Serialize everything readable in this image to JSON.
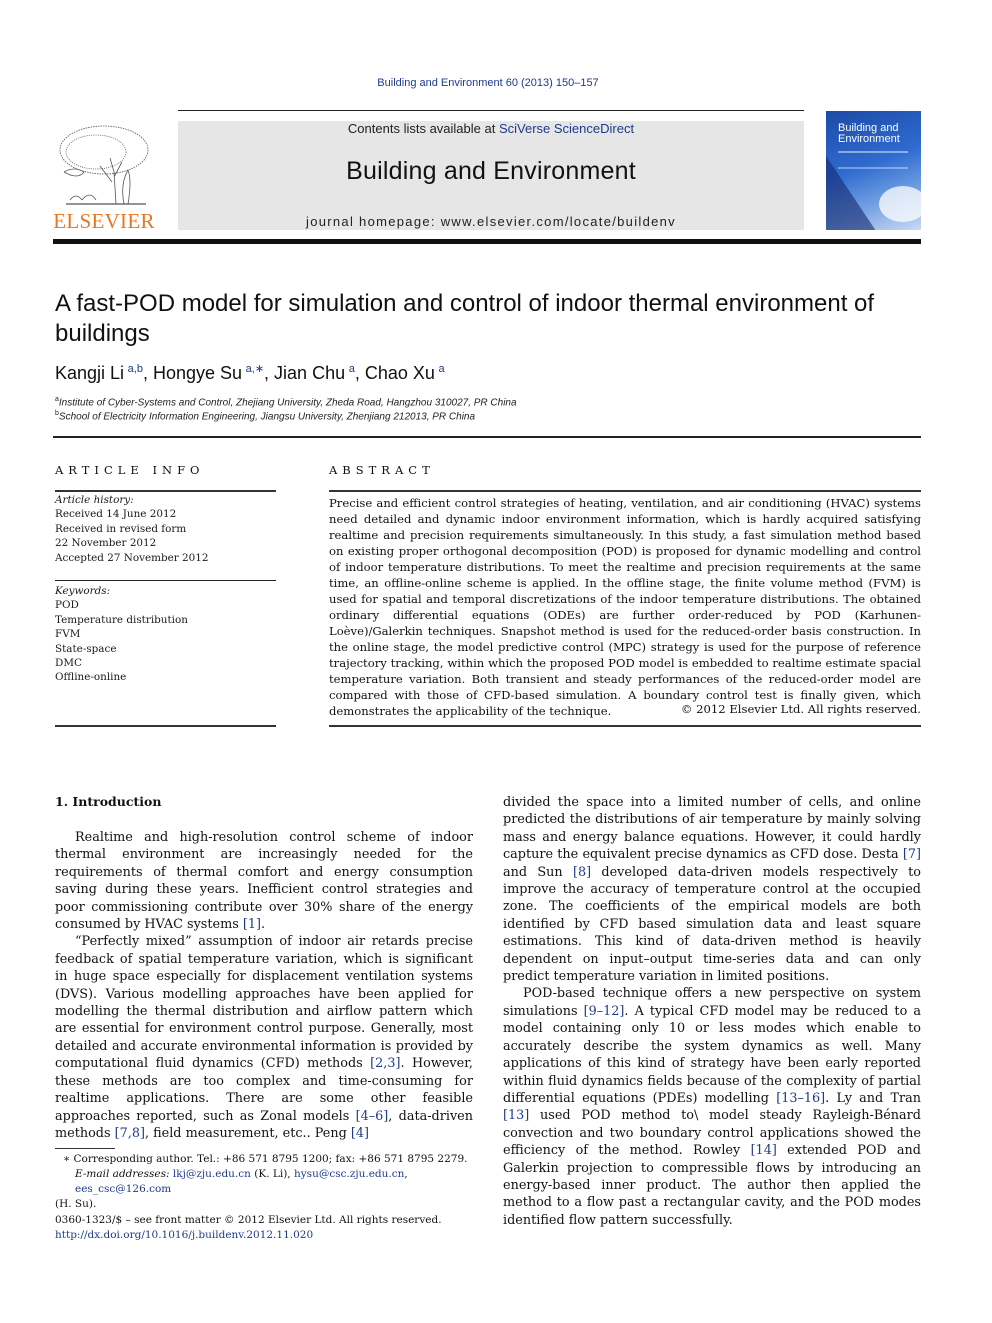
{
  "journal_ref": "Building and Environment 60 (2013) 150–157",
  "masthead": {
    "contents_prefix": "Contents lists available at ",
    "contents_link": "SciVerse ScienceDirect",
    "journal_title": "Building and Environment",
    "homepage": "journal homepage: www.elsevier.com/locate/buildenv",
    "publisher_logo": "ELSEVIER",
    "cover_title_line1": "Building and",
    "cover_title_line2": "Environment"
  },
  "colors": {
    "link": "#1f3a8a",
    "elsevier_orange": "#e87722",
    "masthead_bg": "#e6e6e6"
  },
  "article": {
    "title": "A fast-POD model for simulation and control of indoor thermal environment of buildings",
    "authors": [
      {
        "name": "Kangji Li",
        "sup": "a,b"
      },
      {
        "name": "Hongye Su",
        "sup": "a,∗"
      },
      {
        "name": "Jian Chu",
        "sup": "a"
      },
      {
        "name": "Chao Xu",
        "sup": "a"
      }
    ],
    "affiliations": [
      {
        "mark": "a",
        "text": "Institute of Cyber-Systems and Control, Zhejiang University, Zheda Road, Hangzhou 310027, PR China"
      },
      {
        "mark": "b",
        "text": "School of Electricity Information Engineering, Jiangsu University, Zhenjiang 212013, PR China"
      }
    ]
  },
  "article_info": {
    "heading": "ARTICLE INFO",
    "history_label": "Article history:",
    "history": [
      "Received 14 June 2012",
      "Received in revised form",
      "22 November 2012",
      "Accepted 27 November 2012"
    ],
    "keywords_label": "Keywords:",
    "keywords": [
      "POD",
      "Temperature distribution",
      "FVM",
      "State-space",
      "DMC",
      "Offline-online"
    ]
  },
  "abstract": {
    "heading": "ABSTRACT",
    "text": "Precise and efficient control strategies of heating, ventilation, and air conditioning (HVAC) systems need detailed and dynamic indoor environment information, which is hardly acquired satisfying realtime and precision requirements simultaneously. In this study, a fast simulation method based on existing proper orthogonal decomposition (POD) is proposed for dynamic modelling and control of indoor temperature distributions. To meet the realtime and precision requirements at the same time, an offline-online scheme is applied. In the offline stage, the finite volume method (FVM) is used for spatial and temporal discretizations of the indoor temperature distributions. The obtained ordinary differential equations (ODEs) are further order-reduced by POD (Karhunen-Loève)/Galerkin techniques. Snapshot method is used for the reduced-order basis construction. In the online stage, the model predictive control (MPC) strategy is used for the purpose of reference trajectory tracking, within which the proposed POD model is embedded to realtime estimate spacial temperature variation. Both transient and steady performances of the reduced-order model are compared with those of CFD-based simulation. A boundary control test is finally given, which demonstrates the applicability of the technique.",
    "copyright": "© 2012 Elsevier Ltd. All rights reserved."
  },
  "introduction": {
    "heading": "1.  Introduction",
    "p1_a": "Realtime and high-resolution control scheme of indoor thermal environment are increasingly needed for the requirements of thermal comfort and energy consumption saving during these years. Inefficient control strategies and poor commissioning contribute over 30% share of the energy consumed by HVAC systems ",
    "p1_ref1": "[1]",
    "p1_b": ".",
    "p2_a": "“Perfectly mixed” assumption of indoor air retards precise feedback of spatial temperature variation, which is significant in huge space especially for displacement ventilation systems (DVS). Various modelling approaches have been applied for modelling the thermal distribution and airflow pattern which are essential for environment control purpose. Generally, most detailed and accurate environmental information is provided by computational fluid dynamics (CFD) methods ",
    "p2_ref1": "[2,3]",
    "p2_b": ". However, these methods are too complex and time-consuming for realtime applications. There are some other feasible approaches reported, such as Zonal models ",
    "p2_ref2": "[4–6]",
    "p2_c": ", data-driven methods ",
    "p2_ref3": "[7,8]",
    "p2_d": ", field measurement, etc.. Peng ",
    "p2_ref4": "[4]",
    "r1_a": "divided the space into a limited number of cells, and online predicted the distributions of air temperature by mainly solving mass and energy balance equations. However, it could hardly capture the equivalent precise dynamics as CFD dose. Desta ",
    "r1_ref1": "[7]",
    "r1_b": " and Sun ",
    "r1_ref2": "[8]",
    "r1_c": " developed data-driven models respectively to improve the accuracy of temperature control at the occupied zone. The coefficients of the empirical models are both identified by CFD based simulation data and least square estimations. This kind of data-driven method is heavily dependent on input–output time-series data and can only predict temperature variation in limited positions.",
    "r2_a": "POD-based technique offers a new perspective on system simulations ",
    "r2_ref1": "[9–12]",
    "r2_b": ". A typical CFD model may be reduced to a model containing only 10 or less modes which enable to accurately describe the system dynamics as well. Many applications of this kind of strategy have been early reported within fluid dynamics fields because of the complexity of partial differential equations (PDEs) modelling ",
    "r2_ref2": "[13–16]",
    "r2_c": ". Ly and Tran ",
    "r2_ref3": "[13]",
    "r2_d": " used POD method to\\ model steady Rayleigh-Bénard convection and two boundary control applications showed the efficiency of the method. Rowley ",
    "r2_ref4": "[14]",
    "r2_e": " extended POD and Galerkin projection to compressible flows by introducing an energy-based inner product. The author then applied the method to a flow past a rectangular cavity, and the POD modes identified flow pattern successfully."
  },
  "footnote": {
    "corresponding": "∗  Corresponding author. Tel.: +86 571 8795 1200; fax: +86 571 8795 2279.",
    "email_label": "E-mail addresses:",
    "email1": "lkj@zju.edu.cn",
    "email1_owner": " (K. Li), ",
    "email2": "hysu@csc.zju.edu.cn",
    "sep": ", ",
    "email3": "ees_csc@126.com",
    "email3_owner": "(H. Su)."
  },
  "issn": {
    "line": "0360-1323/$ – see front matter © 2012 Elsevier Ltd. All rights reserved.",
    "doi": "http://dx.doi.org/10.1016/j.buildenv.2012.11.020"
  }
}
